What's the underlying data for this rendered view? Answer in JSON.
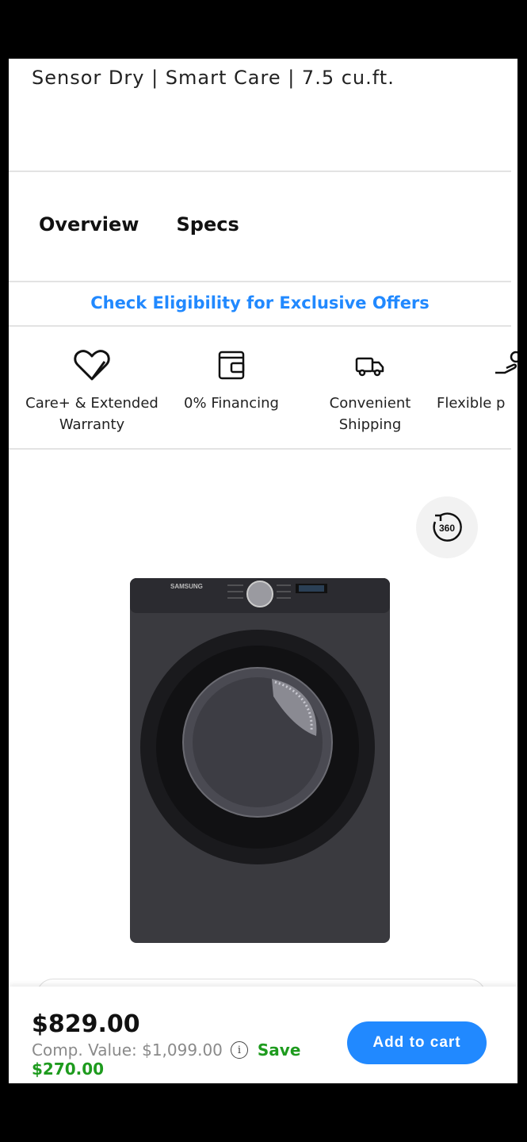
{
  "header": {
    "subtitle": "Sensor Dry | Smart Care | 7.5 cu.ft."
  },
  "tabs": [
    {
      "label": "Overview"
    },
    {
      "label": "Specs"
    }
  ],
  "offers_link": "Check Eligibility for Exclusive Offers",
  "features": [
    {
      "icon": "heart-shield-icon",
      "line1": "Care+ & Extended",
      "line2": "Warranty"
    },
    {
      "icon": "wallet-icon",
      "line1": "0% Financing",
      "line2": ""
    },
    {
      "icon": "truck-icon",
      "line1": "Convenient",
      "line2": "Shipping"
    },
    {
      "icon": "hand-coin-icon",
      "line1": "Flexible p",
      "line2": ""
    }
  ],
  "product": {
    "view_360_label": "360",
    "brand_on_image": "SAMSUNG"
  },
  "price_bar": {
    "price": "$829.00",
    "comp_value": "Comp. Value: $1,099.00",
    "info_symbol": "i",
    "save_label": "Save",
    "save_amount": "$270.00",
    "add_to_cart": "Add to cart"
  },
  "colors": {
    "accent_blue": "#2189ff",
    "save_green": "#1e9b1e",
    "dryer_body": "#3a3a3f"
  }
}
